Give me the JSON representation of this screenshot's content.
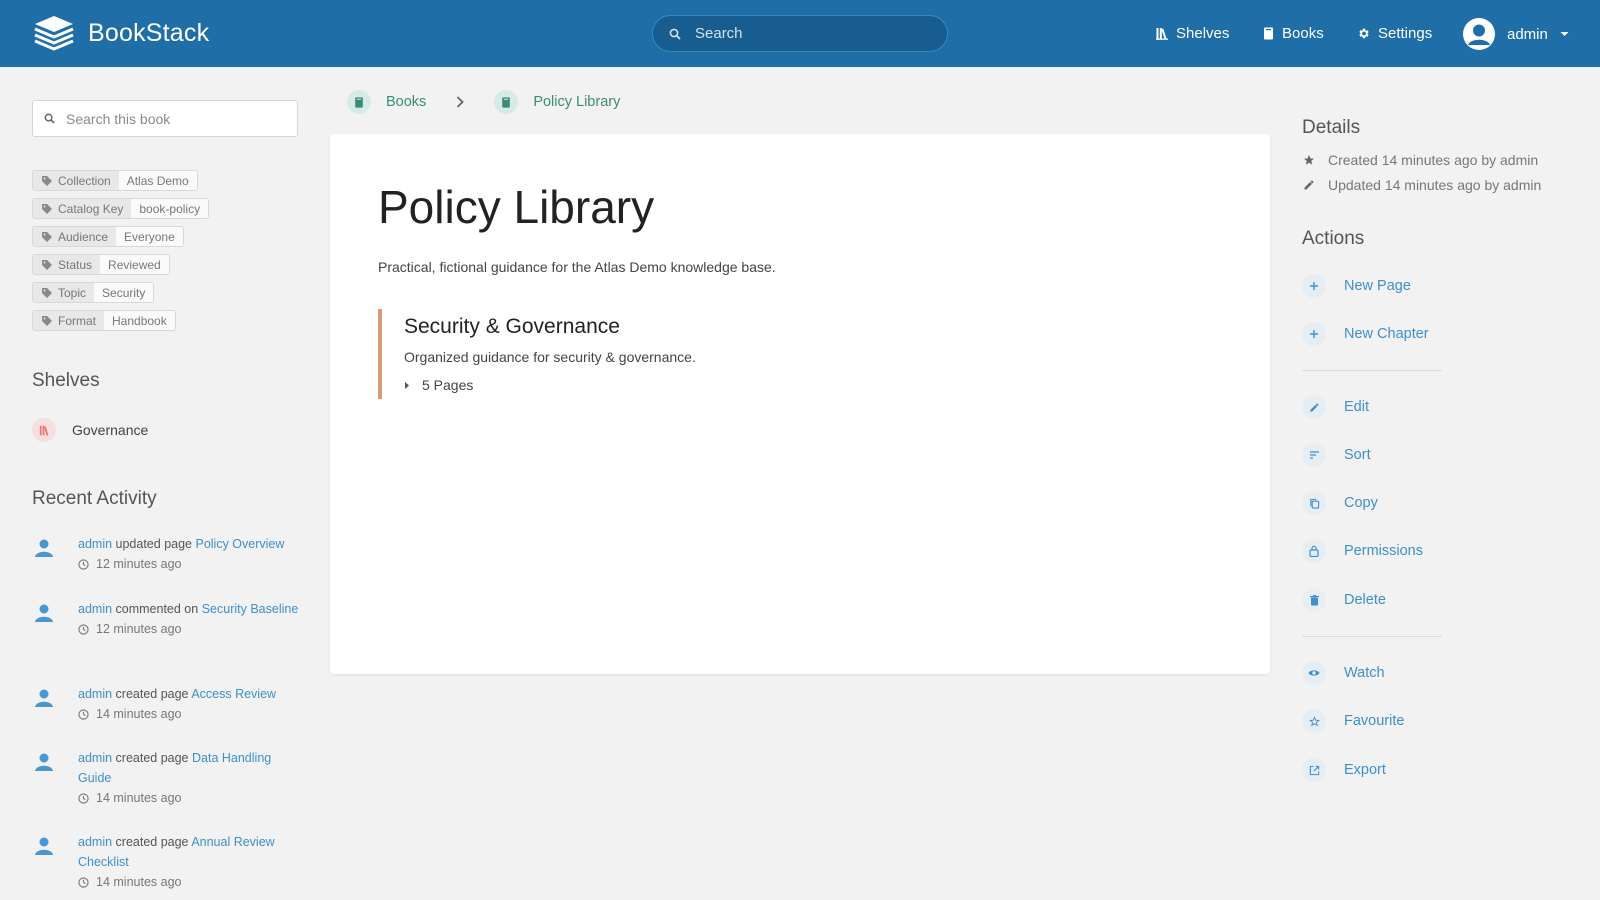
{
  "app": {
    "name": "BookStack"
  },
  "header": {
    "search_placeholder": "Search",
    "nav": {
      "shelves": "Shelves",
      "books": "Books",
      "settings": "Settings"
    },
    "user": "admin"
  },
  "sidebar": {
    "book_search_placeholder": "Search this book",
    "tags": [
      {
        "name": "Collection",
        "value": "Atlas Demo"
      },
      {
        "name": "Catalog Key",
        "value": "book-policy"
      },
      {
        "name": "Audience",
        "value": "Everyone"
      },
      {
        "name": "Status",
        "value": "Reviewed"
      },
      {
        "name": "Topic",
        "value": "Security"
      },
      {
        "name": "Format",
        "value": "Handbook"
      }
    ],
    "shelves_heading": "Shelves",
    "shelves": [
      {
        "name": "Governance"
      }
    ],
    "activity_heading": "Recent Activity",
    "activity": [
      {
        "user": "admin",
        "action": "updated page",
        "target": "Policy Overview",
        "time": "12 minutes ago"
      },
      {
        "user": "admin",
        "action": "commented on",
        "target": "Security Baseline",
        "time": "12 minutes ago"
      },
      {
        "user": "admin",
        "action": "created page",
        "target": "Access Review",
        "time": "14 minutes ago"
      },
      {
        "user": "admin",
        "action": "created page",
        "target": "Data Handling Guide",
        "time": "14 minutes ago"
      },
      {
        "user": "admin",
        "action": "created page",
        "target": "Annual Review Checklist",
        "time": "14 minutes ago"
      }
    ]
  },
  "breadcrumb": {
    "books": "Books",
    "current": "Policy Library"
  },
  "book": {
    "title": "Policy Library",
    "description": "Practical, fictional guidance for the Atlas Demo knowledge base.",
    "chapter": {
      "title": "Security & Governance",
      "description": "Organized guidance for security & governance.",
      "pages": "5 Pages"
    }
  },
  "details": {
    "heading": "Details",
    "created": "Created 14 minutes ago by admin",
    "updated": "Updated 14 minutes ago by admin"
  },
  "actions": {
    "heading": "Actions",
    "new_page": "New Page",
    "new_chapter": "New Chapter",
    "edit": "Edit",
    "sort": "Sort",
    "copy": "Copy",
    "permissions": "Permissions",
    "delete": "Delete",
    "watch": "Watch",
    "favourite": "Favourite",
    "export": "Export"
  },
  "colors": {
    "header": "#206ea7",
    "link": "#3e8fcc",
    "book_green": "#3b8b78",
    "chapter_accent": "#d69b79",
    "shelf_red": "#e57373"
  }
}
